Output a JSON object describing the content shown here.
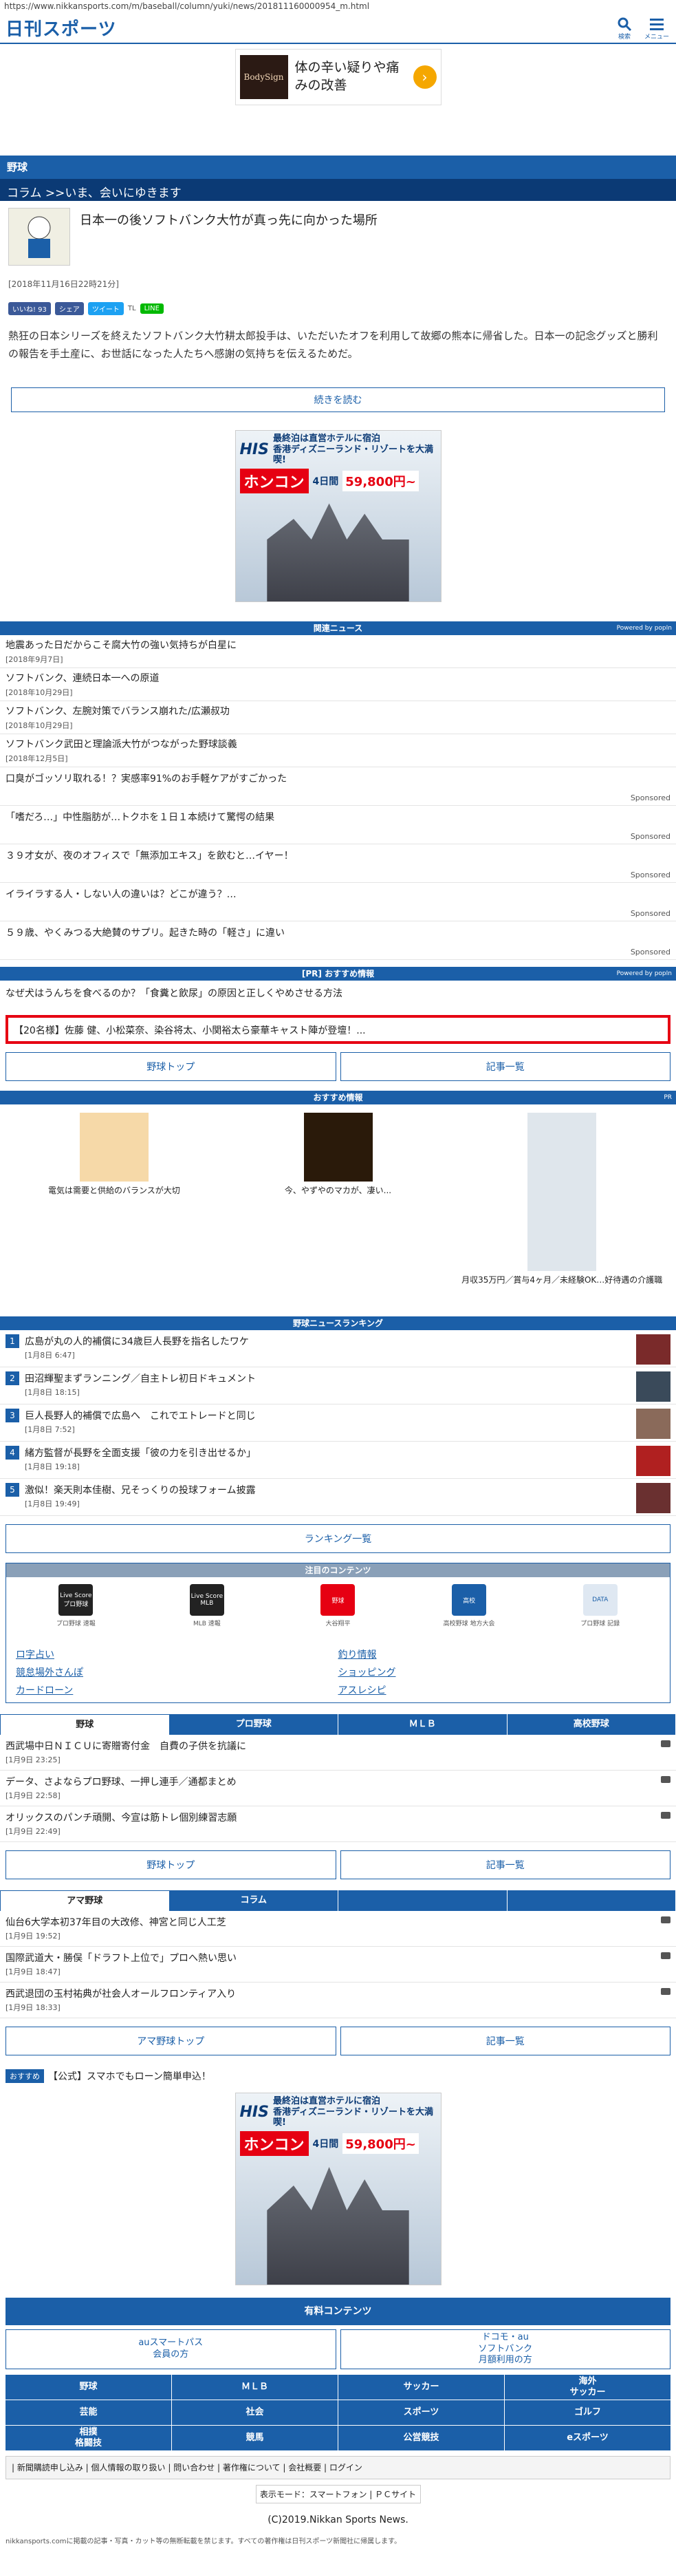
{
  "url": "https://www.nikkansports.com/m/baseball/column/yuki/news/201811160000954_m.html",
  "header": {
    "logo": "日刊スポーツ",
    "search_label": "検索",
    "menu_label": "メニュー"
  },
  "top_ad": {
    "brand": "BodySign",
    "text": "体の辛い疑りや痛みの改善"
  },
  "section": {
    "title": "野球",
    "sub": "コラム >>いま、会いにゆきます"
  },
  "article": {
    "title": "日本一の後ソフトバンク大竹が真っ先に向かった場所",
    "date": "[2018年11月16日22時21分]",
    "lead": "熱狂の日本シリーズを終えたソフトバンク大竹耕太郎投手は、いただいたオフを利用して故郷の熊本に帰省した。日本一の記念グッズと勝利の報告を手土産に、お世話になった人たちへ感謝の気持ちを伝えるためだ。",
    "read_more": "続きを読む"
  },
  "social": {
    "like": "いいね! 93",
    "share": "シェア",
    "tweet": "ツイート",
    "tl": "TL",
    "line": "LINE"
  },
  "his_ad": {
    "logo": "HIS",
    "line1": "最終泊は直営ホテルに宿泊",
    "line2": "香港ディズニーランド・リゾートを大満喫!",
    "place": "ホンコン",
    "days": "4日間",
    "price": "59,800円~"
  },
  "related": {
    "head": "関連ニュース",
    "powered": "Powered by popIn",
    "items": [
      {
        "title": "地震あった日だからこそ腐大竹の強い気持ちが白星に",
        "date": "[2018年9月7日]"
      },
      {
        "title": "ソフトバンク、連続日本一への原道",
        "date": "[2018年10月29日]"
      },
      {
        "title": "ソフトバンク、左腕対策でバランス崩れた/広瀬叔功",
        "date": "[2018年10月29日]"
      },
      {
        "title": "ソフトバンク武田と理論派大竹がつながった野球談義",
        "date": "[2018年12月5日]"
      }
    ],
    "sponsored_label": "Sponsored",
    "sponsored": [
      "口臭がゴッソリ取れる！？実感率91%のお手軽ケアがすごかった",
      "「嗜だろ…」中性脂肪が…トクホを１日１本続けて驚愕の結果",
      "３９才女が、夜のオフィスで「無添加エキス」を飲むと…イヤー！",
      "イライラする人・しない人の違いは？どこが違う？…",
      "５９歳、やくみつる大絶賛のサプリ。起きた時の「軽さ」に違い"
    ]
  },
  "pr_section": {
    "head": "[PR] おすすめ情報",
    "powered": "Powered by popIn",
    "line": "なぜ犬はうんちを食べるのか？「食糞と飲尿」の原因と正しくやめさせる方法",
    "highlight": "【20名様】佐藤 健、小松菜奈、染谷将太、小関裕太ら豪華キャスト陣が登壇！..."
  },
  "nav_buttons": {
    "baseball_top": "野球トップ",
    "article_list": "記事一覧"
  },
  "recommend": {
    "head": "おすすめ情報",
    "pr": "PR",
    "items": [
      "電気は需要と供給のバランスが大切",
      "今、やずやのマカが、凄い...",
      "月収35万円／賞与4ヶ月／未経験OK…好待遇の介護職"
    ]
  },
  "ranking": {
    "head": "野球ニュースランキング",
    "items": [
      {
        "n": "1",
        "title": "広島が丸の人的補償に34歳巨人長野を指名したワケ",
        "date": "[1月8日 6:47]"
      },
      {
        "n": "2",
        "title": "田沼輝聖まずランニング／自主トレ初日ドキュメント",
        "date": "[1月8日 18:15]"
      },
      {
        "n": "3",
        "title": "巨人長野人的補償で広島へ　これでエトレードと同じ",
        "date": "[1月8日 7:52]"
      },
      {
        "n": "4",
        "title": "緒方監督が長野を全面支援「彼の力を引き出せるか」",
        "date": "[1月8日 19:18]"
      },
      {
        "n": "5",
        "title": "激似！楽天則本佳樹、兄そっくりの投球フォーム披露",
        "date": "[1月8日 19:49]"
      }
    ],
    "list_button": "ランキング一覧"
  },
  "attention": {
    "head": "注目のコンテンツ",
    "apps": [
      {
        "logo": "Live Score プロ野球",
        "cap": "プロ野球 速報"
      },
      {
        "logo": "Live Score MLB",
        "cap": "MLB 速報"
      },
      {
        "logo": "野球",
        "cap": "大谷翔平"
      },
      {
        "logo": "高校",
        "cap": "高校野球 地方大会"
      },
      {
        "logo": "DATA",
        "cap": "プロ野球 記録"
      }
    ],
    "links": [
      "ロ字占い",
      "釣り情報",
      "競怠場外さんぽ",
      "ショッピング",
      "カードローン",
      "アスレシピ"
    ]
  },
  "tabs1": {
    "labels": [
      "野球",
      "プロ野球",
      "ＭＬＢ",
      "高校野球"
    ],
    "items": [
      {
        "title": "西武場中日ＮＩＣＵに寄贈寄付金　自費の子供を抗議に",
        "date": "[1月9日 23:25]"
      },
      {
        "title": "データ、さよならプロ野球、一押し連手／通都まとめ",
        "date": "[1月9日 22:58]"
      },
      {
        "title": "オリックスのパンチ頑開、今宣は筋トレ個別練習志願",
        "date": "[1月9日 22:49]"
      }
    ]
  },
  "tabs2": {
    "labels": [
      "アマ野球",
      "コラム",
      "",
      ""
    ],
    "items": [
      {
        "title": "仙台6大学本初37年目の大改修、神宮と同じ人工芝",
        "date": "[1月9日 19:52]"
      },
      {
        "title": "国際武道大・勝俣「ドラフト上位で」プロへ熱い思い",
        "date": "[1月9日 18:47]"
      },
      {
        "title": "西武退団の玉村祐典が社会人オールフロンティア入り",
        "date": "[1月9日 18:33]"
      }
    ],
    "btn_left": "アマ野球トップ",
    "btn_right": "記事一覧"
  },
  "osusume": {
    "tag": "おすすめ",
    "text": "【公式】スマホでもローン簡単申込！"
  },
  "yuryo": {
    "head": "有料コンテンツ",
    "left": "auスマートパス\n会員の方",
    "right": "ドコモ・au\nソフトバンク\n月額利用の方"
  },
  "categories": [
    "野球",
    "ＭＬＢ",
    "サッカー",
    "海外\nサッカー",
    "芸能",
    "社会",
    "スポーツ",
    "ゴルフ",
    "相撲\n格闘技",
    "競馬",
    "公営競技",
    "eスポーツ"
  ],
  "footer": {
    "links": "| 新聞購読申し込み | 個人情報の取り扱い | 問い合わせ | 著作権について | 会社概要 | ログイン",
    "display_mode": "表示モード：スマートフォン | ＰＣサイト",
    "copyright": "(C)2019.Nikkan Sports News.",
    "note": "nikkansports.comに掲載の記事・写真・カット等の無断転載を禁じます。すべての著作権は日刊スポーツ新聞社に帰属します。"
  },
  "colors": {
    "brand": "#1b5fa8",
    "dark": "#0b3a75",
    "alert": "#e60012"
  }
}
